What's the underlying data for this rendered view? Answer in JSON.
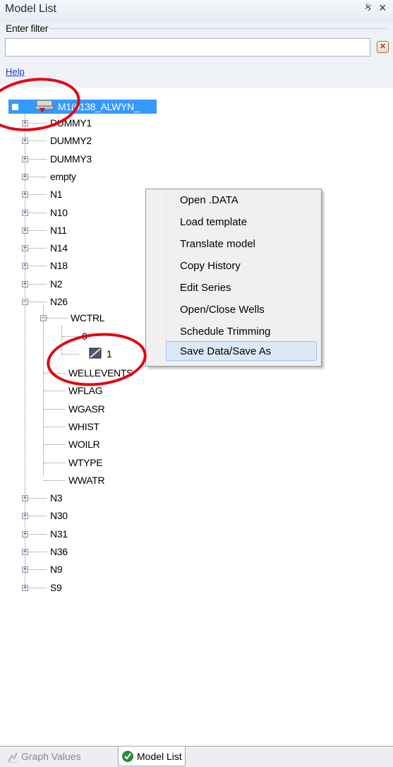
{
  "panel": {
    "title": "Model List",
    "pin_glyph": "ક",
    "close_glyph": "×"
  },
  "filter": {
    "label": "Enter filter",
    "value": "",
    "placeholder": "",
    "clear_icon": "clear-filter-icon",
    "help_link": "Help"
  },
  "tree": {
    "root": {
      "label": "M1(0138_ALWYN_"
    },
    "items": [
      "DUMMY1",
      "DUMMY2",
      "DUMMY3",
      "empty",
      "N1",
      "N10",
      "N11",
      "N14",
      "N18",
      "N2",
      "N26"
    ],
    "n26_children": {
      "wctrl": "WCTRL",
      "wctrl_children": [
        "0",
        "1"
      ],
      "others": [
        "WELLEVENTS",
        "WFLAG",
        "WGASR",
        "WHIST",
        "WOILR",
        "WTYPE",
        "WWATR"
      ]
    },
    "items_after": [
      "N3",
      "N30",
      "N31",
      "N36",
      "N9",
      "S9"
    ]
  },
  "context_menu": {
    "items": [
      "Open .DATA",
      "Load template",
      "Translate model",
      "Copy History",
      "Edit Series",
      "Open/Close Wells",
      "Schedule Trimming",
      "Save Data/Save As"
    ],
    "highlighted": "Save Data/Save As"
  },
  "tabs": {
    "graph_values": "Graph Values",
    "model_list": "Model List",
    "active": "Model List"
  },
  "colors": {
    "selection": "#3399ff",
    "annotation_circle": "#e30613",
    "link": "#1a38c9"
  }
}
